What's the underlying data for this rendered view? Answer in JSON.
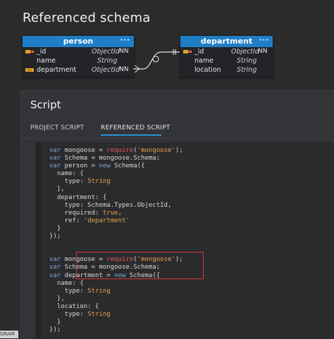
{
  "page": {
    "title": "Referenced schema"
  },
  "entities": {
    "person": {
      "name": "person",
      "menu": "···",
      "fields": [
        {
          "name": "_id",
          "type": "ObjectId",
          "nn": "NN",
          "icon": "key-fk-icon"
        },
        {
          "name": "name",
          "type": "String",
          "nn": "",
          "icon": ""
        },
        {
          "name": "department",
          "type": "ObjectId",
          "nn": "NN",
          "icon": "fk-icon"
        }
      ]
    },
    "department": {
      "name": "department",
      "menu": "···",
      "fields": [
        {
          "name": "_id",
          "type": "ObjectId",
          "nn": "NN",
          "icon": "key-fk-icon"
        },
        {
          "name": "name",
          "type": "String",
          "nn": "",
          "icon": ""
        },
        {
          "name": "location",
          "type": "String",
          "nn": "",
          "icon": ""
        }
      ]
    }
  },
  "script_panel": {
    "title": "Script",
    "tabs": [
      {
        "label": "PROJECT SCRIPT",
        "active": false
      },
      {
        "label": "REFERENCED SCRIPT",
        "active": true
      }
    ]
  },
  "code": {
    "lines": [
      "var mongoose = require('mongoose');",
      "var Schema = mongoose.Schema;",
      "var person = new Schema({",
      "  name: {",
      "    type: String",
      "  },",
      "  department: {",
      "    type: Schema.Types.ObjectId,",
      "    required: true,",
      "    ref: 'department'",
      "  }",
      "});",
      "",
      "",
      "var mongoose = require('mongoose');",
      "var Schema = mongoose.Schema;",
      "var department = new Schema({",
      "  name: {",
      "    type: String",
      "  },",
      "  location: {",
      "    type: String",
      "  }",
      "});"
    ]
  },
  "footer": {
    "corner_label": "GRAM"
  },
  "colors": {
    "accent": "#1f7ec6",
    "highlight": "#d8343a",
    "tab_underline": "#2b8fd9"
  }
}
